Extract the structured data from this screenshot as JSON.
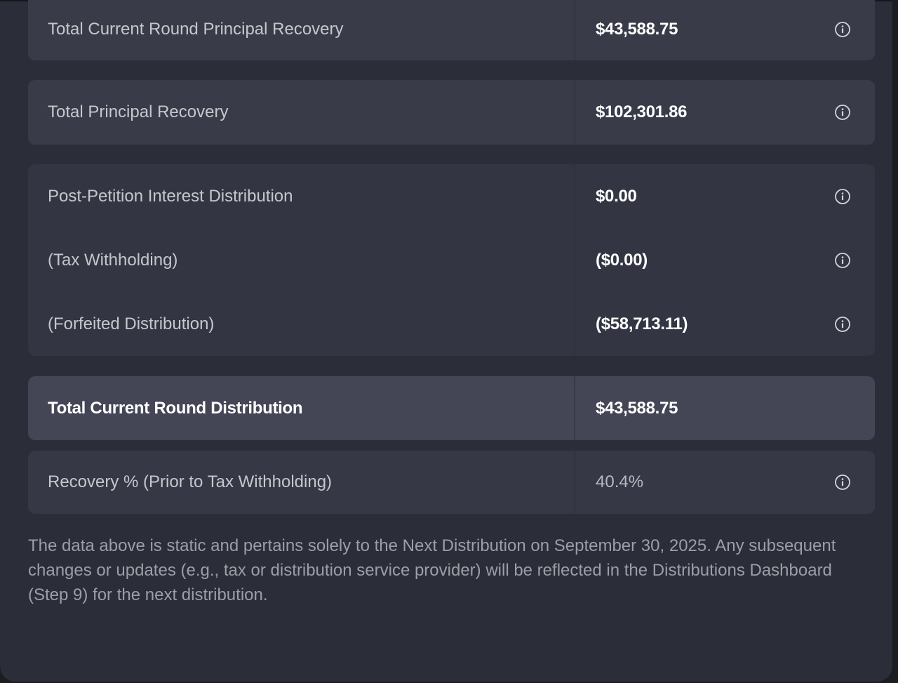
{
  "rows": {
    "current_round_principal": {
      "label": "Total Current Round Principal Recovery",
      "value": "$43,588.75",
      "icon": "info-icon"
    },
    "total_principal": {
      "label": "Total Principal Recovery",
      "value": "$102,301.86",
      "icon": "info-icon"
    },
    "post_petition_interest": {
      "label": "Post-Petition Interest Distribution",
      "value": "$0.00",
      "icon": "info-icon"
    },
    "tax_withholding": {
      "label": "(Tax Withholding)",
      "value": "($0.00)",
      "icon": "info-icon"
    },
    "forfeited_distribution": {
      "label": "(Forfeited Distribution)",
      "value": "($58,713.11)",
      "icon": "info-icon"
    },
    "total_current_round_distribution": {
      "label": "Total Current Round Distribution",
      "value": "$43,588.75"
    },
    "recovery_percent": {
      "label": "Recovery % (Prior to Tax Withholding)",
      "value": "40.4%",
      "icon": "info-icon"
    }
  },
  "note": "The data above is static and pertains solely to the Next Distribution on September 30, 2025. Any subsequent changes or updates (e.g., tax or distribution service provider) will be reflected in the Distributions Dashboard (Step 9) for the next distribution.",
  "colors": {
    "background": "#2b2d38",
    "card": "#393b48",
    "card_highlight": "#444655",
    "text_primary": "#ffffff",
    "text_secondary": "#c6c7cd",
    "text_muted": "#9d9ea6"
  }
}
